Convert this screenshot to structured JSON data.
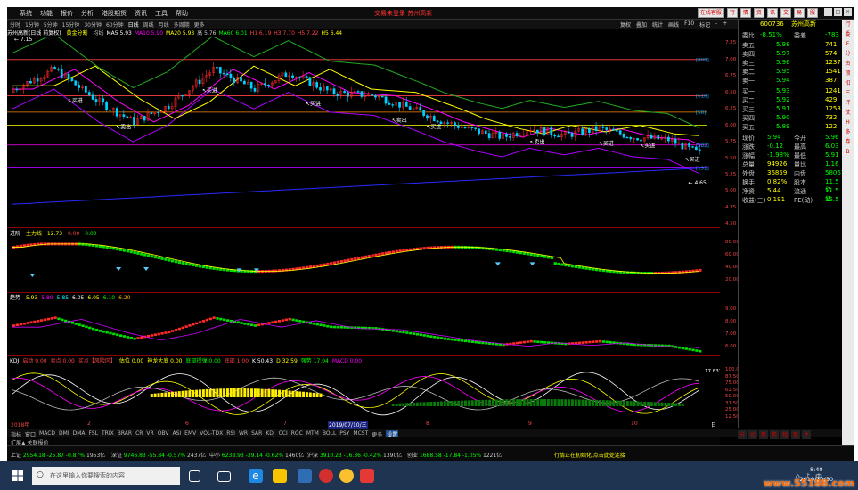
{
  "menu": {
    "items": [
      "系统",
      "功能",
      "报价",
      "分析",
      "港股期货",
      "资讯",
      "工具",
      "帮助"
    ],
    "app_title": "交易未登录  苏州高新",
    "top_buttons": [
      "在线客服",
      "行",
      "情",
      "资",
      "讯",
      "交",
      "易",
      "服"
    ]
  },
  "periods": [
    "分时",
    "1分钟",
    "5分钟",
    "15分钟",
    "30分钟",
    "60分钟",
    "日线",
    "周线",
    "月线",
    "多周期",
    "更多"
  ],
  "view_tabs": [
    "复权",
    "叠加",
    "统计",
    "画线",
    "F10",
    "标记",
    "-",
    "+"
  ],
  "stock_info": {
    "name": "苏州高新(日线 前复权)",
    "indicator": "黄金分割",
    "ma_line": [
      "均线",
      "MA5 5.93",
      "MA10 5.90",
      "MA20 5.93",
      "高 5.76",
      "MA60 6.01",
      "H1 6.19",
      "H3 7.70",
      "H5 7.22",
      "H5 6.44"
    ]
  },
  "main_axis": [
    "7.25",
    "7.00",
    "6.75",
    "6.50",
    "6.25",
    "6.00",
    "5.75",
    "5.50",
    "5.25",
    "5.00",
    "4.75",
    "4.50"
  ],
  "golden_labels": [
    "[809]",
    "[618]",
    "[50]",
    "[382]",
    "[191]"
  ],
  "trade_marks": [
    "买进",
    "卖出",
    "买进",
    "买进",
    "卖出",
    "买进",
    "卖出",
    "买进",
    "买进",
    "买进"
  ],
  "min_price_label": "4.65",
  "max_price_label": "7.15",
  "pane1": {
    "name": "进阶",
    "label": "主力线",
    "v1": "12.73",
    "v2": "0.00",
    "v3": "0.00",
    "axis": [
      "80.00",
      "60.00",
      "40.00",
      "20.00"
    ]
  },
  "pane2": {
    "name": "趋势",
    "values": [
      "5.93",
      "5.89",
      "5.85",
      "6.05",
      "6.05",
      "6.10",
      "6.20"
    ],
    "axis": [
      "9.00",
      "8.00",
      "7.00",
      "6.00"
    ]
  },
  "pane3": {
    "name": "KDJ",
    "values": [
      "KDJ 16.89",
      "启动 0.00",
      "卖点 0.00",
      "买点【风险区】",
      "估位 0.00",
      "神龙大底 0.00",
      "底部拐弹 0.00",
      "底部 1.00",
      "K 50.43",
      "D 32.59",
      "强势 17.04",
      "MACD 0.00"
    ],
    "peak": "17.837",
    "axis": [
      "100.0",
      "87.50",
      "75.00",
      "62.50",
      "50.00",
      "37.50",
      "25.00",
      "12.50"
    ]
  },
  "dates": [
    "2018年",
    "2",
    "6",
    "7",
    "2019/07/10/三",
    "8",
    "9",
    "10",
    "日线"
  ],
  "indicator_tabs": [
    "指标",
    "窗口",
    "MACD",
    "DMI",
    "DMA",
    "FSL",
    "TRIX",
    "BRAR",
    "CR",
    "VR",
    "OBV",
    "ASI",
    "EMV",
    "VOL-TDX",
    "RSI",
    "WR",
    "SAR",
    "KDJ",
    "CCI",
    "ROC",
    "MTM",
    "BOLL",
    "PSY",
    "MCST",
    "更多",
    "设置"
  ],
  "ext_tab": "扩展▲ 关联报价",
  "quote": {
    "code": "600736",
    "name": "苏州高新",
    "wb_label": "委比",
    "wb": "-8.51%",
    "wb_diff": "委差",
    "wb_diff_val": "-783",
    "asks": [
      [
        "卖五",
        "5.98",
        "741"
      ],
      [
        "卖四",
        "5.97",
        "574"
      ],
      [
        "卖三",
        "5.96",
        "1237"
      ],
      [
        "卖二",
        "5.95",
        "1541"
      ],
      [
        "卖一",
        "5.94",
        "387"
      ]
    ],
    "bids": [
      [
        "买一",
        "5.93",
        "1241"
      ],
      [
        "买二",
        "5.92",
        "429"
      ],
      [
        "买三",
        "5.91",
        "1253"
      ],
      [
        "买四",
        "5.90",
        "732"
      ],
      [
        "买五",
        "5.89",
        "122"
      ]
    ],
    "stats": [
      [
        "现价",
        "5.94",
        "今开",
        "5.96"
      ],
      [
        "涨跌",
        "-0.12",
        "最高",
        "6.03"
      ],
      [
        "涨幅",
        "-1.98%",
        "最低",
        "5.91"
      ],
      [
        "总量",
        "94926",
        "量比",
        "1.16"
      ],
      [
        "外盘",
        "36859",
        "内盘",
        "58067"
      ],
      [
        "换手",
        "0.82%",
        "股本",
        "11.5亿"
      ],
      [
        "净资",
        "5.44",
        "流通",
        "11.5亿"
      ],
      [
        "收益(三)",
        "0.191",
        "PE(动)",
        "15.5"
      ]
    ]
  },
  "right_tabs": [
    "分",
    "价",
    "笔",
    "势",
    "指",
    "联",
    "主"
  ],
  "side_nav": [
    "行",
    "委",
    "F",
    "分",
    "资",
    "顶",
    "扣",
    "三",
    "评",
    "仗",
    "H",
    "多",
    "券",
    "B"
  ],
  "status": [
    {
      "name": "上证",
      "val": "2954.18",
      "chg": "-25.87",
      "pct": "-0.87%",
      "amt": "1953亿"
    },
    {
      "name": "深证",
      "val": "9746.83",
      "chg": "-55.84",
      "pct": "-0.57%",
      "amt": "2437亿"
    },
    {
      "name": "中小",
      "val": "6238.93",
      "chg": "-39.14",
      "pct": "-0.62%",
      "amt": "1460亿"
    },
    {
      "name": "沪深",
      "val": "3910.23",
      "chg": "-16.36",
      "pct": "-0.42%",
      "amt": "1390亿"
    },
    {
      "name": "创业",
      "val": "1688.58",
      "chg": "-17.84",
      "pct": "-1.05%",
      "amt": "1221亿"
    }
  ],
  "status_msg": "行情正在初始化,点击此处连接",
  "taskbar": {
    "search_placeholder": "在这里输入你要搜索的内容",
    "time": "8:40",
    "date": "2019/10/30",
    "lang": "中"
  },
  "watermark": "www.55188.com",
  "colors": {
    "up": "#ff2a2a",
    "down": "#00e000",
    "ma5": "#ff00ff",
    "ma10": "#ffff00",
    "bg": "#000000"
  },
  "icons": [
    "windows-start-icon",
    "search-icon",
    "task-view-icon",
    "edge-icon",
    "file-explorer-icon",
    "store-icon",
    "app-icon"
  ]
}
